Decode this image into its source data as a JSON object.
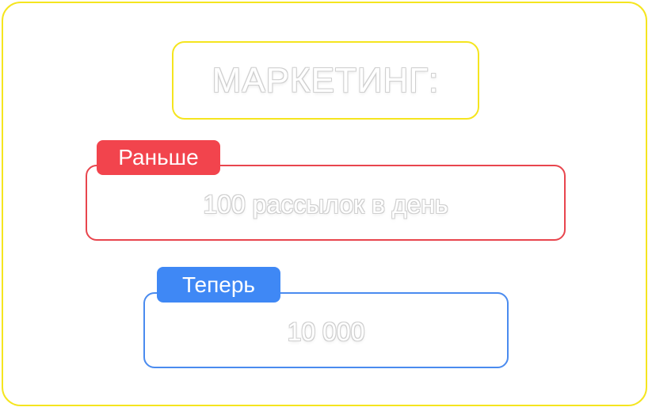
{
  "title": "МАРКЕТИНГ:",
  "before": {
    "label": "Раньше",
    "value": "100 рассылок в день"
  },
  "now": {
    "label": "Теперь",
    "value": "10 000"
  },
  "colors": {
    "frame": "#f5e51f",
    "before_accent": "#f2444d",
    "now_accent": "#3f88f5"
  }
}
